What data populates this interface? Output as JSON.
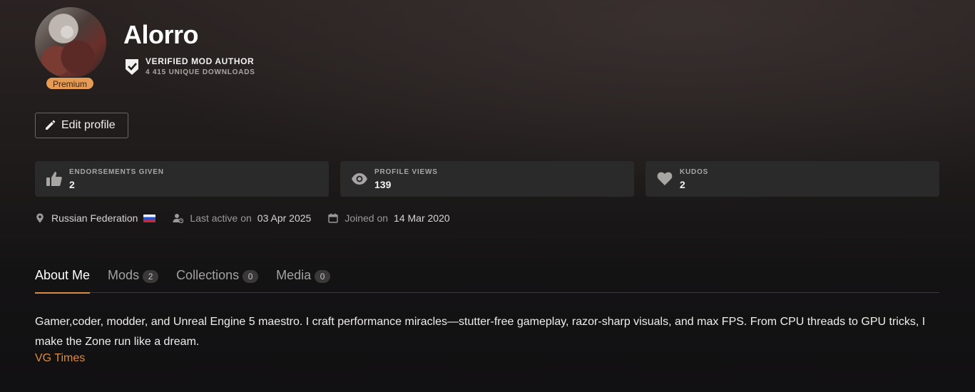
{
  "profile": {
    "name": "Alorro",
    "premium_label": "Premium",
    "verified_label": "VERIFIED MOD AUTHOR",
    "downloads_label": "4 415 UNIQUE DOWNLOADS"
  },
  "actions": {
    "edit_label": "Edit profile"
  },
  "stats": [
    {
      "label": "ENDORSEMENTS GIVEN",
      "value": "2",
      "icon": "thumbs-up-icon"
    },
    {
      "label": "PROFILE VIEWS",
      "value": "139",
      "icon": "eye-icon"
    },
    {
      "label": "KUDOS",
      "value": "2",
      "icon": "heart-icon"
    }
  ],
  "meta": {
    "country": "Russian Federation",
    "last_active_label": "Last active on",
    "last_active_date": "03 Apr 2025",
    "joined_label": "Joined on",
    "joined_date": "14 Mar 2020"
  },
  "tabs": [
    {
      "label": "About Me",
      "count": null,
      "active": true
    },
    {
      "label": "Mods",
      "count": "2",
      "active": false
    },
    {
      "label": "Collections",
      "count": "0",
      "active": false
    },
    {
      "label": "Media",
      "count": "0",
      "active": false
    }
  ],
  "about": {
    "text": "Gamer,coder, modder, and Unreal Engine 5 maestro. I craft performance miracles—stutter-free gameplay, razor-sharp visuals, and max FPS. From CPU threads to GPU tricks, I make the Zone run like a dream.",
    "link_label": "VG Times"
  },
  "colors": {
    "accent": "#d98b45",
    "premium": "#e69b55",
    "link": "#e08a3c",
    "card": "#2b2a2b"
  }
}
